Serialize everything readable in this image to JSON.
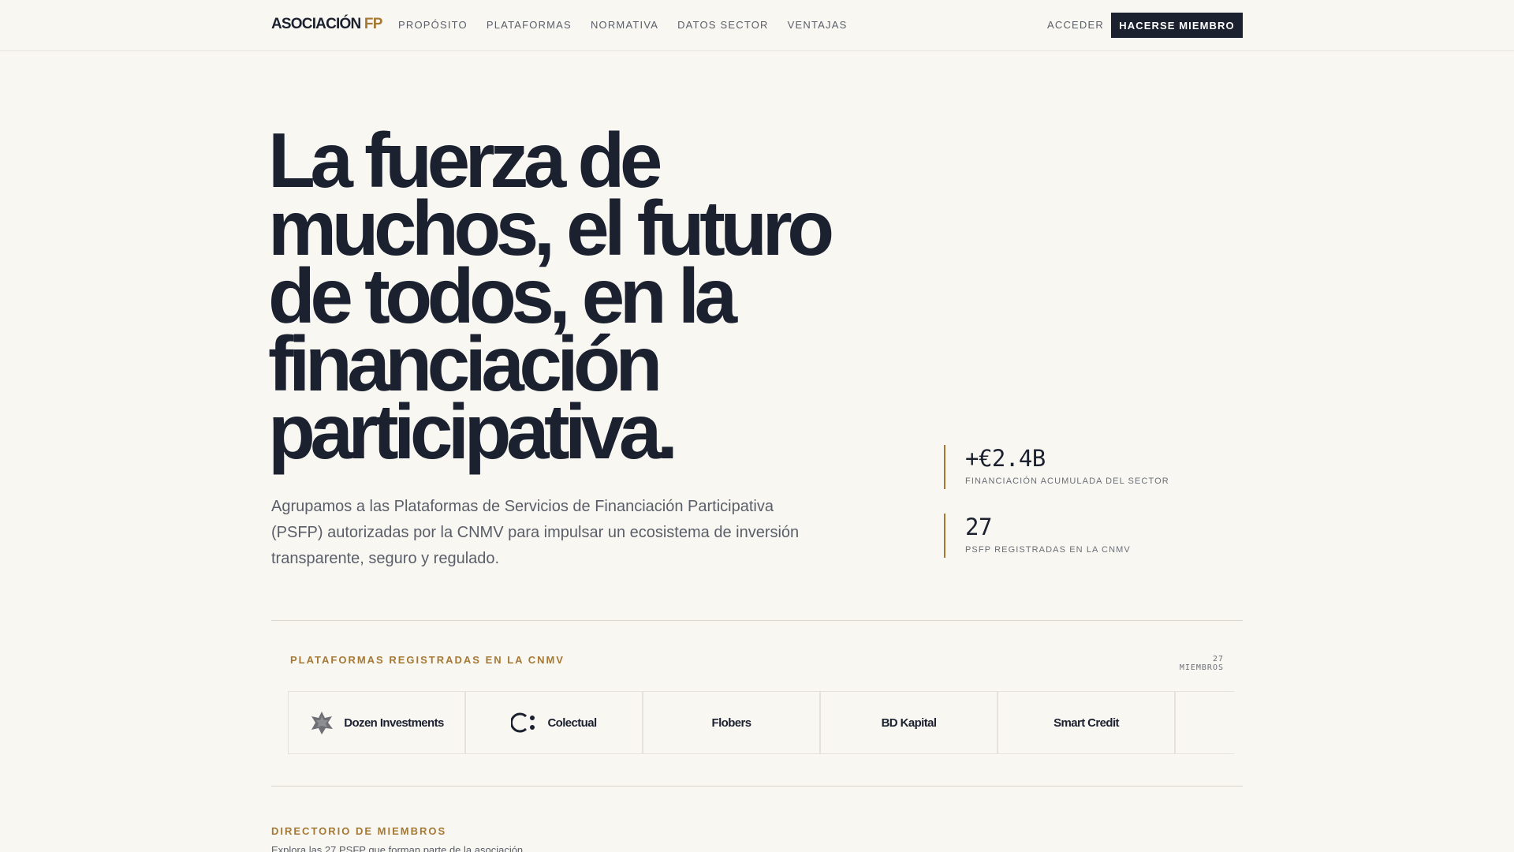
{
  "brand": {
    "logo_main": "ASOCIACIÓN",
    "logo_accent": "FP",
    "accent_color": "#a57834",
    "dark_color": "#1c2130"
  },
  "nav": {
    "links": [
      "PROPÓSITO",
      "PLATAFORMAS",
      "NORMATIVA",
      "DATOS SECTOR",
      "VENTAJAS"
    ],
    "login_label": "ACCEDER",
    "join_label": "HACERSE MIEMBRO"
  },
  "hero": {
    "title_lines": [
      "La fuerza de",
      "muchos, el futuro",
      "de todos, en la",
      "financiación",
      "participativa."
    ],
    "subtitle": "Agrupamos a las Plataformas de Servicios de Financiación Participativa (PSFP) autorizadas por la CNMV para impulsar un ecosistema de inversión transparente, seguro y regulado."
  },
  "stats": [
    {
      "value": "+€2.4B",
      "label": "FINANCIACIÓN ACUMULADA DEL SECTOR"
    },
    {
      "value": "27",
      "label": "PSFP REGISTRADAS EN LA CNMV"
    }
  ],
  "platforms": {
    "heading": "PLATAFORMAS REGISTRADAS EN LA CNMV",
    "count": "27 MIEMBROS",
    "items": [
      {
        "name": "Dozen Investments",
        "icon": "star-badge-icon"
      },
      {
        "name": "Colectual",
        "icon": "circle-dots-icon"
      },
      {
        "name": "Flobers",
        "icon": ""
      },
      {
        "name": "BD Kapital",
        "icon": ""
      },
      {
        "name": "Smart Credit",
        "icon": ""
      }
    ]
  },
  "directory": {
    "heading": "DIRECTORIO DE MIEMBROS",
    "subtitle": "Explora las 27 PSFP que forman parte de la asociación."
  }
}
